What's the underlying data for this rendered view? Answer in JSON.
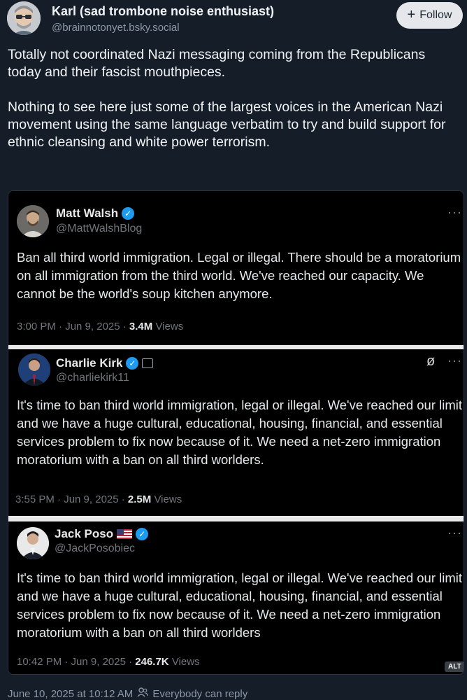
{
  "author": {
    "name": "Karl (sad trombone noise enthusiast)",
    "handle": "@brainnotonyet.bsky.social"
  },
  "follow_label": "Follow",
  "post_text": {
    "paragraph1": "Totally not coordinated Nazi messaging coming from the Republicans today and their fascist mouthpieces.",
    "paragraph2": "Nothing to see here just some of the largest voices in the American Nazi movement using the same language verbatim to try and build support for ethnic cleansing and white power terrorism."
  },
  "embedded_tweets": [
    {
      "name": "Matt Walsh",
      "handle": "@MattWalshBlog",
      "text": "Ban all third world immigration. Legal or illegal. There should be a moratorium on all immigration from the third world. We've reached our capacity. We cannot be the world's soup kitchen anymore.",
      "time": "3:00 PM · Jun 9, 2025 · ",
      "views_count": "3.4M",
      "views_label": "Views"
    },
    {
      "name": "Charlie Kirk",
      "handle": "@charliekirk11",
      "text": "It's time to ban third world immigration, legal or illegal. We've reached our limit and we have a huge cultural, educational, housing, financial, and essential services problem to fix now because of it. We need a net-zero immigration moratorium with a ban on all third worlders.",
      "time": "3:55 PM · Jun 9, 2025 · ",
      "views_count": "2.5M",
      "views_label": "Views"
    },
    {
      "name": "Jack Poso",
      "handle": "@JackPosobiec",
      "text": "It's time to ban third world immigration, legal or illegal. We've reached our limit and we have a huge cultural, educational, housing, financial, and essential services problem to fix now because of it. We need a net-zero immigration moratorium with a ban on all third worlders",
      "time": "10:42 PM · Jun 9, 2025 · ",
      "views_count": "246.7K",
      "views_label": "Views"
    }
  ],
  "more_glyph": "···",
  "alt_label": "ALT",
  "footer": {
    "timestamp": "June 10, 2025 at 10:12 AM",
    "reply_setting": "Everybody can reply"
  },
  "colors": {
    "background": "#151d28",
    "verified": "#1d9bf0",
    "muted": "#8d98a5"
  }
}
